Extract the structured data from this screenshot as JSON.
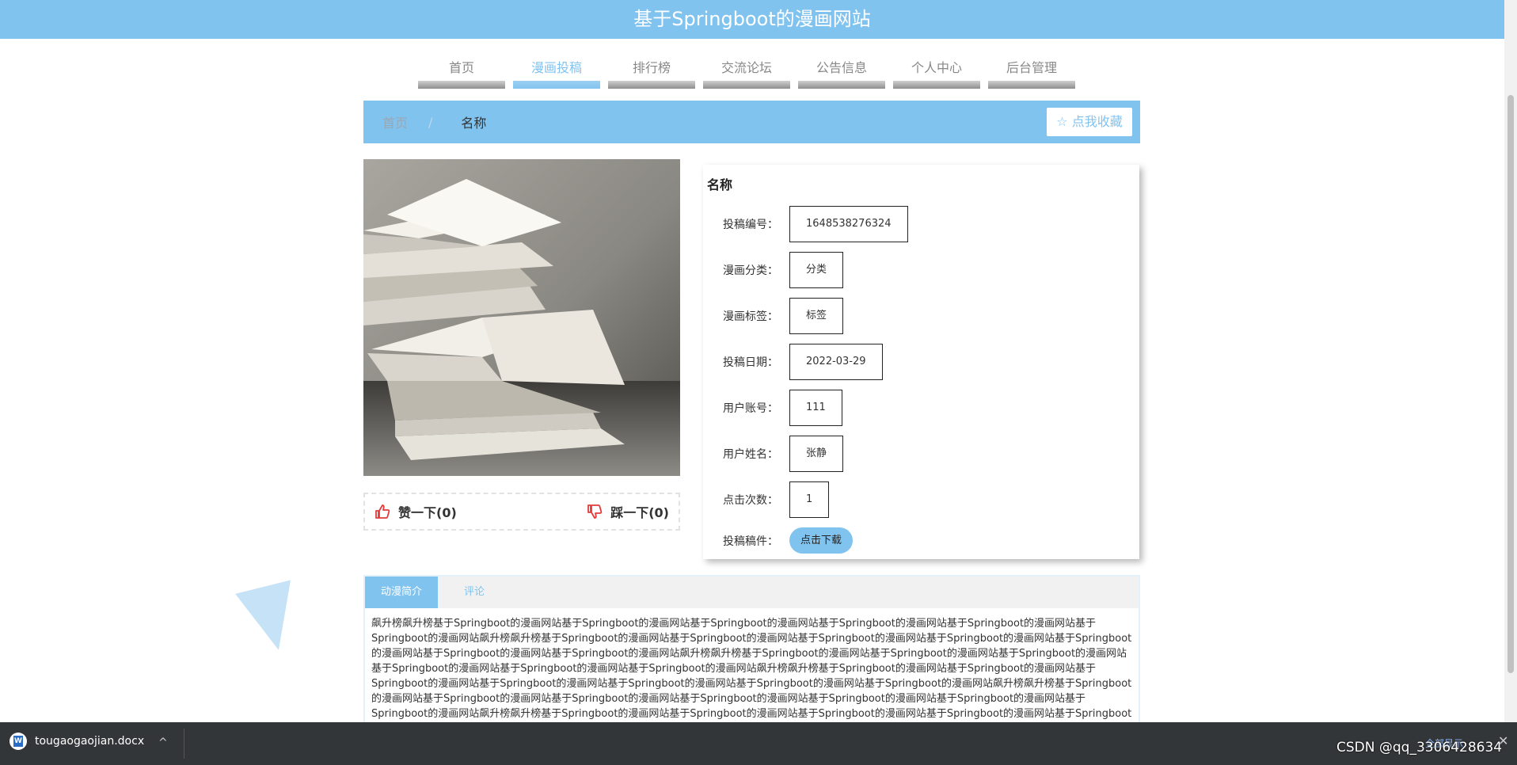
{
  "header": {
    "title": "基于Springboot的漫画网站"
  },
  "nav": {
    "items": [
      {
        "label": "首页",
        "active": false
      },
      {
        "label": "漫画投稿",
        "active": true
      },
      {
        "label": "排行榜",
        "active": false
      },
      {
        "label": "交流论坛",
        "active": false
      },
      {
        "label": "公告信息",
        "active": false
      },
      {
        "label": "个人中心",
        "active": false
      },
      {
        "label": "后台管理",
        "active": false
      }
    ]
  },
  "breadcrumb": {
    "home": "首页",
    "separator": "/",
    "current": "名称"
  },
  "favorite": {
    "label": "☆ 点我收藏"
  },
  "vote": {
    "like_label": "赞一下(0)",
    "dislike_label": "踩一下(0)"
  },
  "detail": {
    "title": "名称",
    "fields": [
      {
        "label": "投稿编号：",
        "value": "1648538276324"
      },
      {
        "label": "漫画分类：",
        "value": "分类"
      },
      {
        "label": "漫画标签：",
        "value": "标签"
      },
      {
        "label": "投稿日期：",
        "value": "2022-03-29"
      },
      {
        "label": "用户账号：",
        "value": "111"
      },
      {
        "label": "用户姓名：",
        "value": "张静"
      },
      {
        "label": "点击次数：",
        "value": "1"
      }
    ],
    "attachment_label": "投稿稿件：",
    "download_label": "点击下载"
  },
  "tabs": {
    "items": [
      "动漫简介",
      "评论"
    ],
    "active_index": 0,
    "intro_text": "飙升榜飙升榜基于Springboot的漫画网站基于Springboot的漫画网站基于Springboot的漫画网站基于Springboot的漫画网站基于Springboot的漫画网站基于Springboot的漫画网站飙升榜飙升榜基于Springboot的漫画网站基于Springboot的漫画网站基于Springboot的漫画网站基于Springboot的漫画网站基于Springboot的漫画网站基于Springboot的漫画网站基于Springboot的漫画网站飙升榜飙升榜基于Springboot的漫画网站基于Springboot的漫画网站基于Springboot的漫画网站基于Springboot的漫画网站基于Springboot的漫画网站基于Springboot的漫画网站飙升榜飙升榜基于Springboot的漫画网站基于Springboot的漫画网站基于Springboot的漫画网站基于Springboot的漫画网站基于Springboot的漫画网站基于Springboot的漫画网站基于Springboot的漫画网站飙升榜飙升榜基于Springboot的漫画网站基于Springboot的漫画网站基于Springboot的漫画网站基于Springboot的漫画网站基于Springboot的漫画网站基于Springboot的漫画网站基于Springboot的漫画网站飙升榜飙升榜基于Springboot的漫画网站基于Springboot的漫画网站基于Springboot的漫画网站基于Springboot的漫画网站基于Springboot的漫画网站基于Springboot的漫画网站基于Springboot的漫画网"
  },
  "download_bar": {
    "file_name": "tougaogaojian.docx",
    "show_all": "全部显示",
    "close_glyph": "✕",
    "chevron_glyph": "^"
  },
  "watermark": "CSDN @qq_3306428634",
  "colors": {
    "primary": "#81c3ef",
    "download_bar": "#333638"
  },
  "icons": [
    "thumbs-up-icon",
    "thumbs-down-icon",
    "star-icon",
    "word-doc-icon",
    "book-stack-image"
  ]
}
